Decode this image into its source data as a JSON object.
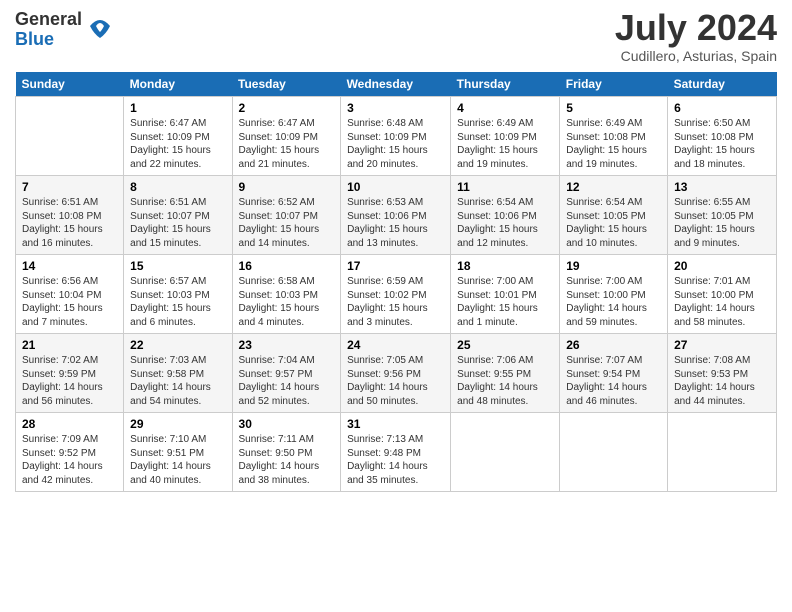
{
  "header": {
    "logo_general": "General",
    "logo_blue": "Blue",
    "month_year": "July 2024",
    "location": "Cudillero, Asturias, Spain"
  },
  "calendar": {
    "days_of_week": [
      "Sunday",
      "Monday",
      "Tuesday",
      "Wednesday",
      "Thursday",
      "Friday",
      "Saturday"
    ],
    "weeks": [
      [
        {
          "day": "",
          "info": ""
        },
        {
          "day": "1",
          "info": "Sunrise: 6:47 AM\nSunset: 10:09 PM\nDaylight: 15 hours\nand 22 minutes."
        },
        {
          "day": "2",
          "info": "Sunrise: 6:47 AM\nSunset: 10:09 PM\nDaylight: 15 hours\nand 21 minutes."
        },
        {
          "day": "3",
          "info": "Sunrise: 6:48 AM\nSunset: 10:09 PM\nDaylight: 15 hours\nand 20 minutes."
        },
        {
          "day": "4",
          "info": "Sunrise: 6:49 AM\nSunset: 10:09 PM\nDaylight: 15 hours\nand 19 minutes."
        },
        {
          "day": "5",
          "info": "Sunrise: 6:49 AM\nSunset: 10:08 PM\nDaylight: 15 hours\nand 19 minutes."
        },
        {
          "day": "6",
          "info": "Sunrise: 6:50 AM\nSunset: 10:08 PM\nDaylight: 15 hours\nand 18 minutes."
        }
      ],
      [
        {
          "day": "7",
          "info": "Sunrise: 6:51 AM\nSunset: 10:08 PM\nDaylight: 15 hours\nand 16 minutes."
        },
        {
          "day": "8",
          "info": "Sunrise: 6:51 AM\nSunset: 10:07 PM\nDaylight: 15 hours\nand 15 minutes."
        },
        {
          "day": "9",
          "info": "Sunrise: 6:52 AM\nSunset: 10:07 PM\nDaylight: 15 hours\nand 14 minutes."
        },
        {
          "day": "10",
          "info": "Sunrise: 6:53 AM\nSunset: 10:06 PM\nDaylight: 15 hours\nand 13 minutes."
        },
        {
          "day": "11",
          "info": "Sunrise: 6:54 AM\nSunset: 10:06 PM\nDaylight: 15 hours\nand 12 minutes."
        },
        {
          "day": "12",
          "info": "Sunrise: 6:54 AM\nSunset: 10:05 PM\nDaylight: 15 hours\nand 10 minutes."
        },
        {
          "day": "13",
          "info": "Sunrise: 6:55 AM\nSunset: 10:05 PM\nDaylight: 15 hours\nand 9 minutes."
        }
      ],
      [
        {
          "day": "14",
          "info": "Sunrise: 6:56 AM\nSunset: 10:04 PM\nDaylight: 15 hours\nand 7 minutes."
        },
        {
          "day": "15",
          "info": "Sunrise: 6:57 AM\nSunset: 10:03 PM\nDaylight: 15 hours\nand 6 minutes."
        },
        {
          "day": "16",
          "info": "Sunrise: 6:58 AM\nSunset: 10:03 PM\nDaylight: 15 hours\nand 4 minutes."
        },
        {
          "day": "17",
          "info": "Sunrise: 6:59 AM\nSunset: 10:02 PM\nDaylight: 15 hours\nand 3 minutes."
        },
        {
          "day": "18",
          "info": "Sunrise: 7:00 AM\nSunset: 10:01 PM\nDaylight: 15 hours\nand 1 minute."
        },
        {
          "day": "19",
          "info": "Sunrise: 7:00 AM\nSunset: 10:00 PM\nDaylight: 14 hours\nand 59 minutes."
        },
        {
          "day": "20",
          "info": "Sunrise: 7:01 AM\nSunset: 10:00 PM\nDaylight: 14 hours\nand 58 minutes."
        }
      ],
      [
        {
          "day": "21",
          "info": "Sunrise: 7:02 AM\nSunset: 9:59 PM\nDaylight: 14 hours\nand 56 minutes."
        },
        {
          "day": "22",
          "info": "Sunrise: 7:03 AM\nSunset: 9:58 PM\nDaylight: 14 hours\nand 54 minutes."
        },
        {
          "day": "23",
          "info": "Sunrise: 7:04 AM\nSunset: 9:57 PM\nDaylight: 14 hours\nand 52 minutes."
        },
        {
          "day": "24",
          "info": "Sunrise: 7:05 AM\nSunset: 9:56 PM\nDaylight: 14 hours\nand 50 minutes."
        },
        {
          "day": "25",
          "info": "Sunrise: 7:06 AM\nSunset: 9:55 PM\nDaylight: 14 hours\nand 48 minutes."
        },
        {
          "day": "26",
          "info": "Sunrise: 7:07 AM\nSunset: 9:54 PM\nDaylight: 14 hours\nand 46 minutes."
        },
        {
          "day": "27",
          "info": "Sunrise: 7:08 AM\nSunset: 9:53 PM\nDaylight: 14 hours\nand 44 minutes."
        }
      ],
      [
        {
          "day": "28",
          "info": "Sunrise: 7:09 AM\nSunset: 9:52 PM\nDaylight: 14 hours\nand 42 minutes."
        },
        {
          "day": "29",
          "info": "Sunrise: 7:10 AM\nSunset: 9:51 PM\nDaylight: 14 hours\nand 40 minutes."
        },
        {
          "day": "30",
          "info": "Sunrise: 7:11 AM\nSunset: 9:50 PM\nDaylight: 14 hours\nand 38 minutes."
        },
        {
          "day": "31",
          "info": "Sunrise: 7:13 AM\nSunset: 9:48 PM\nDaylight: 14 hours\nand 35 minutes."
        },
        {
          "day": "",
          "info": ""
        },
        {
          "day": "",
          "info": ""
        },
        {
          "day": "",
          "info": ""
        }
      ]
    ]
  }
}
